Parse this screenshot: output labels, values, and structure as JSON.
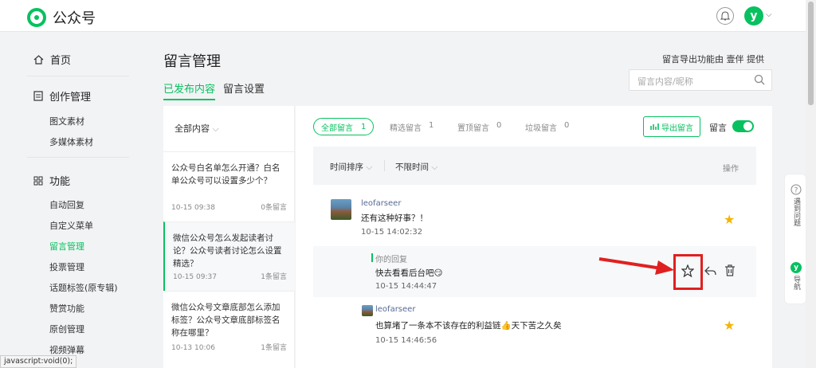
{
  "header": {
    "app_name": "公众号",
    "avatar_letter": "y"
  },
  "sidebar": {
    "home": "首页",
    "create": {
      "title": "创作管理",
      "items": [
        "图文素材",
        "多媒体素材"
      ]
    },
    "features": {
      "title": "功能",
      "items": [
        "自动回复",
        "自定义菜单",
        "留言管理",
        "投票管理",
        "话题标签(原专辑)",
        "赞赏功能",
        "原创管理",
        "视频弹幕"
      ],
      "active": "留言管理"
    }
  },
  "page": {
    "title": "留言管理",
    "tabs": [
      "已发布内容",
      "留言设置"
    ],
    "provider_note": "留言导出功能由 壹伴 提供",
    "search_placeholder": "留言内容/昵称"
  },
  "articles": {
    "filter_label": "全部内容",
    "list": [
      {
        "title": "公众号白名单怎么开通？白名单公众号可以设置多少个？",
        "date": "10-15 09:38",
        "count": "0条留言"
      },
      {
        "title": "微信公众号怎么发起读者讨论？公众号读者讨论怎么设置精选？",
        "date": "10-15 09:37",
        "count": "1条留言"
      },
      {
        "title": "微信公众号文章底部怎么添加标签？公众号文章底部标签名称在哪里？",
        "date": "10-13 10:06",
        "count": "1条留言"
      }
    ]
  },
  "comments_panel": {
    "filters": [
      {
        "label": "全部留言",
        "count": "1"
      },
      {
        "label": "精选留言",
        "count": "1"
      },
      {
        "label": "置顶留言",
        "count": "0"
      },
      {
        "label": "垃圾留言",
        "count": "0"
      }
    ],
    "export_label": "导出留言",
    "toggle_label": "留言",
    "sort_label": "时间排序",
    "time_label": "不限时间",
    "action_header": "操作",
    "comments": [
      {
        "user": "leofarseer",
        "text": "还有这种好事？！",
        "time": "10-15 14:02:32"
      },
      {
        "user": "leofarseer",
        "text": "也算堵了一条本不该存在的利益链👍天下苦之久矣",
        "time": "10-15 14:46:56"
      }
    ],
    "reply": {
      "label": "你的回复",
      "text": "快去看看后台吧😏",
      "time": "10-15 14:44:47"
    }
  },
  "float_panel": {
    "help": "遇到问题",
    "nav": "导航"
  },
  "status_bar": "javascript:void(0);",
  "colors": {
    "accent": "#07c160",
    "highlight": "#e02020",
    "star": "#f5b400"
  }
}
